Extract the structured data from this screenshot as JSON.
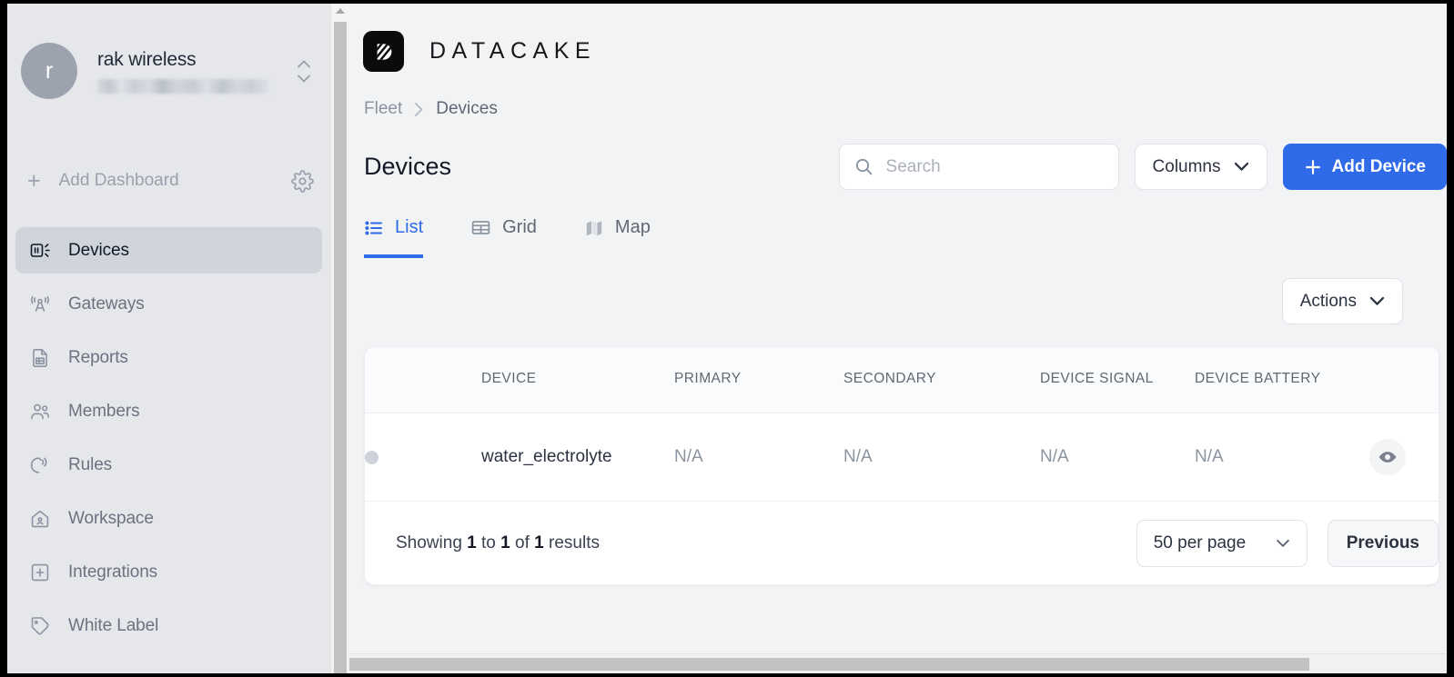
{
  "sidebar": {
    "org": {
      "avatar_initial": "r",
      "name": "rak wireless",
      "sub_redacted": true,
      "switcher_icon": "chevron-up-down-icon"
    },
    "add_dashboard": {
      "plus_icon": "plus-icon",
      "label": "Add Dashboard",
      "settings_icon": "gear-icon"
    },
    "items": [
      {
        "label": "Devices",
        "icon": "devices-icon",
        "active": true
      },
      {
        "label": "Gateways",
        "icon": "gateway-icon",
        "active": false
      },
      {
        "label": "Reports",
        "icon": "report-icon",
        "active": false
      },
      {
        "label": "Members",
        "icon": "members-icon",
        "active": false
      },
      {
        "label": "Rules",
        "icon": "rules-icon",
        "active": false
      },
      {
        "label": "Workspace",
        "icon": "workspace-icon",
        "active": false
      },
      {
        "label": "Integrations",
        "icon": "integrations-icon",
        "active": false
      },
      {
        "label": "White Label",
        "icon": "tag-icon",
        "active": false
      }
    ]
  },
  "brand": {
    "logo_icon": "datacake-logo-icon",
    "wordmark": "DATACAKE"
  },
  "breadcrumb": {
    "parent": "Fleet",
    "separator": "›",
    "current": "Devices"
  },
  "header": {
    "title": "Devices",
    "search": {
      "icon": "search-icon",
      "value": "",
      "placeholder": "Search"
    },
    "columns_button": {
      "label": "Columns",
      "icon": "chevron-down-icon"
    },
    "add_device_button": {
      "label": "Add Device",
      "icon": "plus-icon"
    }
  },
  "tabs": [
    {
      "label": "List",
      "icon": "list-icon",
      "active": true
    },
    {
      "label": "Grid",
      "icon": "grid-icon",
      "active": false
    },
    {
      "label": "Map",
      "icon": "map-icon",
      "active": false
    }
  ],
  "actions_button": {
    "label": "Actions",
    "icon": "chevron-down-icon"
  },
  "table": {
    "columns": [
      {
        "key": "status",
        "label": ""
      },
      {
        "key": "device",
        "label": "DEVICE"
      },
      {
        "key": "primary",
        "label": "PRIMARY"
      },
      {
        "key": "secondary",
        "label": "SECONDARY"
      },
      {
        "key": "signal",
        "label": "DEVICE SIGNAL"
      },
      {
        "key": "battery",
        "label": "DEVICE BATTERY"
      },
      {
        "key": "view",
        "label": ""
      }
    ],
    "rows": [
      {
        "status": {
          "icon": "status-dot-icon",
          "color": "#ced2da"
        },
        "device": "water_electrolyte",
        "primary": "N/A",
        "secondary": "N/A",
        "signal": "N/A",
        "battery": "N/A",
        "view": {
          "icon": "eye-icon"
        }
      }
    ]
  },
  "footer": {
    "showing_prefix": "Showing",
    "from": "1",
    "mid": "to",
    "to": "1",
    "of": "of",
    "total": "1",
    "suffix": "results",
    "per_page": {
      "value": "50 per page",
      "icon": "chevron-down-icon"
    },
    "previous_button": "Previous"
  },
  "scrollbars": {
    "sidebar_vertical": "vertical-scrollbar",
    "main_horizontal": "horizontal-scrollbar"
  },
  "colors": {
    "accent": "#2f6ae8",
    "sidebar_bg": "#e5e7eb",
    "sidebar_active": "#d0d4db",
    "page_bg": "#f2f3f5",
    "card_bg": "#ffffff",
    "muted_text": "#8b94a1",
    "status_dot": "#ced2da"
  }
}
